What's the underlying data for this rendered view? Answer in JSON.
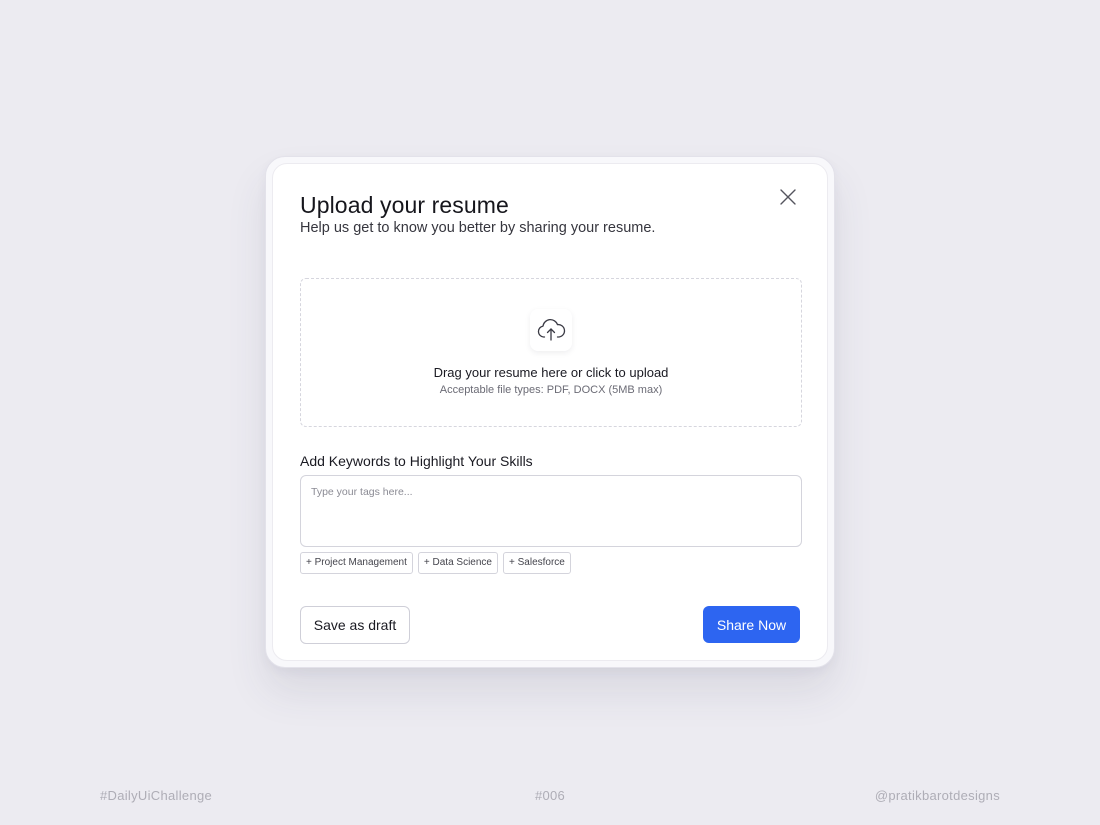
{
  "modal": {
    "title": "Upload your resume",
    "subtitle": "Help us get to know you better by sharing your resume.",
    "close_icon": "close-icon"
  },
  "dropzone": {
    "icon": "cloud-upload-icon",
    "title": "Drag your resume here or click to upload",
    "hint": "Acceptable file types: PDF, DOCX (5MB max)"
  },
  "keywords": {
    "label": "Add Keywords to Highlight Your Skills",
    "value": "",
    "placeholder": "Type your tags here...",
    "suggestions": [
      {
        "label": "+ Project Management"
      },
      {
        "label": "+ Data Science"
      },
      {
        "label": "+ Salesforce"
      }
    ]
  },
  "actions": {
    "draft_label": "Save as draft",
    "share_label": "Share Now"
  },
  "footer": {
    "left": "#DailyUiChallenge",
    "center": "#006",
    "right": "@pratikbarotdesigns"
  },
  "colors": {
    "background": "#ecebf1",
    "primary": "#2d65f1",
    "card": "#ffffff"
  }
}
